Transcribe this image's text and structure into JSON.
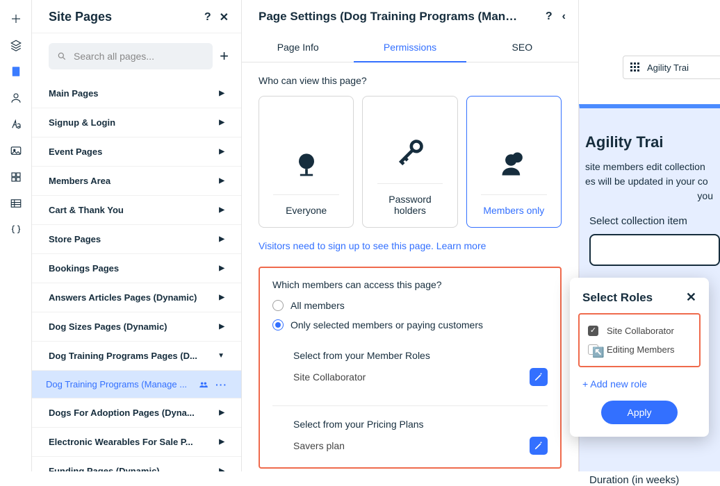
{
  "rail": {
    "icons": [
      "plus",
      "layers",
      "page",
      "person",
      "type",
      "image",
      "apps",
      "table",
      "braces"
    ]
  },
  "sidebar": {
    "title": "Site Pages",
    "search_placeholder": "Search all pages...",
    "categories": [
      {
        "label": "Main Pages",
        "expanded": false
      },
      {
        "label": "Signup & Login",
        "expanded": false
      },
      {
        "label": "Event Pages",
        "expanded": false
      },
      {
        "label": "Members Area",
        "expanded": false
      },
      {
        "label": "Cart & Thank You",
        "expanded": false
      },
      {
        "label": "Store Pages",
        "expanded": false
      },
      {
        "label": "Bookings Pages",
        "expanded": false
      },
      {
        "label": "Answers Articles Pages (Dynamic)",
        "expanded": false
      },
      {
        "label": "Dog Sizes Pages (Dynamic)",
        "expanded": false
      },
      {
        "label": "Dog Training Programs Pages (D...",
        "expanded": true,
        "items": [
          {
            "label": "Dog Training Programs (Manage ...",
            "selected": true
          }
        ]
      },
      {
        "label": "Dogs For Adoption Pages (Dyna...",
        "expanded": false
      },
      {
        "label": "Electronic Wearables For Sale P...",
        "expanded": false
      },
      {
        "label": "Funding Pages (Dynamic)",
        "expanded": false
      }
    ]
  },
  "panel": {
    "title": "Page Settings (Dog Training Programs (Manage ...",
    "tabs": [
      {
        "label": "Page Info",
        "active": false
      },
      {
        "label": "Permissions",
        "active": true
      },
      {
        "label": "SEO",
        "active": false
      }
    ],
    "view_q": "Who can view this page?",
    "cards": [
      {
        "id": "everyone",
        "label": "Everyone",
        "selected": false
      },
      {
        "id": "password",
        "label": "Password holders",
        "selected": false
      },
      {
        "id": "members",
        "label": "Members only",
        "selected": true
      }
    ],
    "signup_note_prefix": "Visitors need to sign up to see this page. ",
    "signup_note_link": "Learn more",
    "access_q": "Which members can access this page?",
    "radios": [
      {
        "id": "all",
        "label": "All members",
        "checked": false
      },
      {
        "id": "sel",
        "label": "Only selected members or paying customers",
        "checked": true
      }
    ],
    "roles_hdr": "Select from your Member Roles",
    "roles_value": "Site Collaborator",
    "plans_hdr": "Select from your Pricing Plans",
    "plans_value": "Savers plan"
  },
  "roles_pop": {
    "title": "Select Roles",
    "options": [
      {
        "label": "Site Collaborator",
        "checked": true
      },
      {
        "label": "Editing Members",
        "checked": false
      }
    ],
    "add_label": "+ Add new role",
    "apply_label": "Apply"
  },
  "bg": {
    "toolbar_label": "Agility Trai",
    "h2": "Agility Trai",
    "p1": "site members edit collection",
    "p2": "es will be updated in your co",
    "p3": "you",
    "field_label": "Select collection item",
    "duration_label": "Duration (in weeks)"
  }
}
